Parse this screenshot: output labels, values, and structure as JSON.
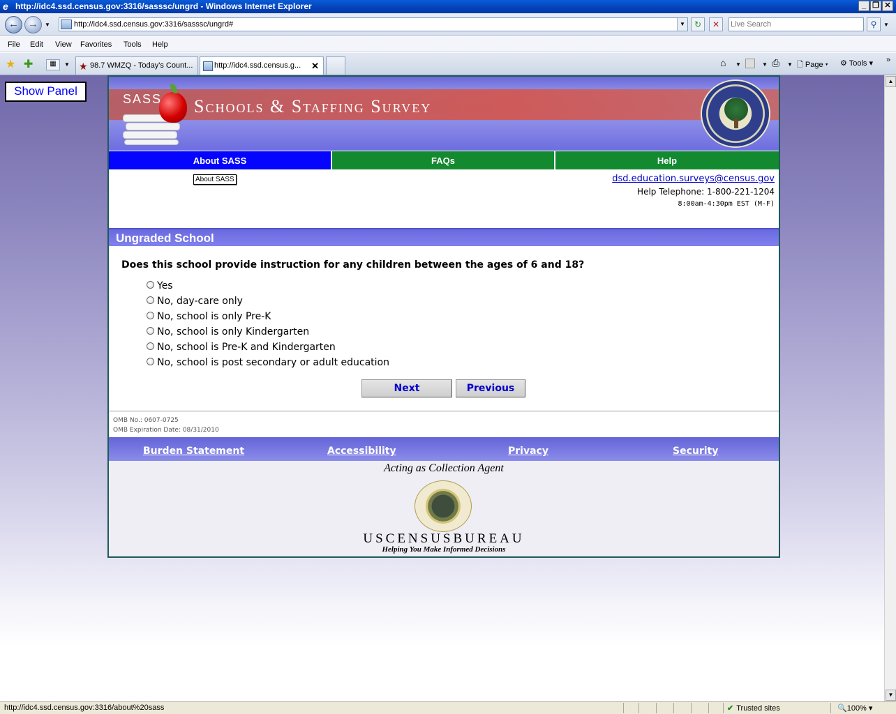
{
  "window": {
    "title": "http://idc4.ssd.census.gov:3316/sasssc/ungrd - Windows Internet Explorer"
  },
  "browser": {
    "address": "http://idc4.ssd.census.gov:3316/sasssc/ungrd#",
    "search_placeholder": "Live Search",
    "menu": [
      "File",
      "Edit",
      "View",
      "Favorites",
      "Tools",
      "Help"
    ],
    "tabs": [
      {
        "label": "98.7 WMZQ - Today's Count..."
      },
      {
        "label": "http://idc4.ssd.census.g..."
      }
    ],
    "toolbar": {
      "page": "Page",
      "tools": "Tools"
    },
    "status_url": "http://idc4.ssd.census.gov:3316/about%20sass",
    "zone": "Trusted sites",
    "zoom": "100%"
  },
  "show_panel_label": "Show Panel",
  "banner": {
    "sass": "SASS",
    "title": "Schools & Staffing Survey"
  },
  "nav": [
    {
      "label": "About SASS"
    },
    {
      "label": "FAQs"
    },
    {
      "label": "Help"
    }
  ],
  "tooltip": "About SASS",
  "contact": {
    "email": "dsd.education.surveys@census.gov",
    "phone": "Help Telephone: 1-800-221-1204",
    "hours": "8:00am-4:30pm EST (M-F)"
  },
  "section_title": "Ungraded School",
  "question": "Does this school provide instruction for any children between the ages of 6 and 18?",
  "options": [
    "Yes",
    "No, day-care only",
    "No, school is only Pre-K",
    "No, school is only Kindergarten",
    "No, school is Pre-K and Kindergarten",
    "No, school is post secondary or adult education"
  ],
  "buttons": {
    "next": "Next",
    "previous": "Previous"
  },
  "omb": {
    "number": "OMB No.: 0607-0725",
    "expiration": "OMB Expiration Date: 08/31/2010"
  },
  "footer_links": [
    "Burden Statement",
    "Accessibility",
    "Privacy",
    "Security"
  ],
  "agent": {
    "acting": "Acting as Collection Agent",
    "bureau": "USCENSUSBUREAU",
    "tagline": "Helping You Make Informed Decisions"
  }
}
